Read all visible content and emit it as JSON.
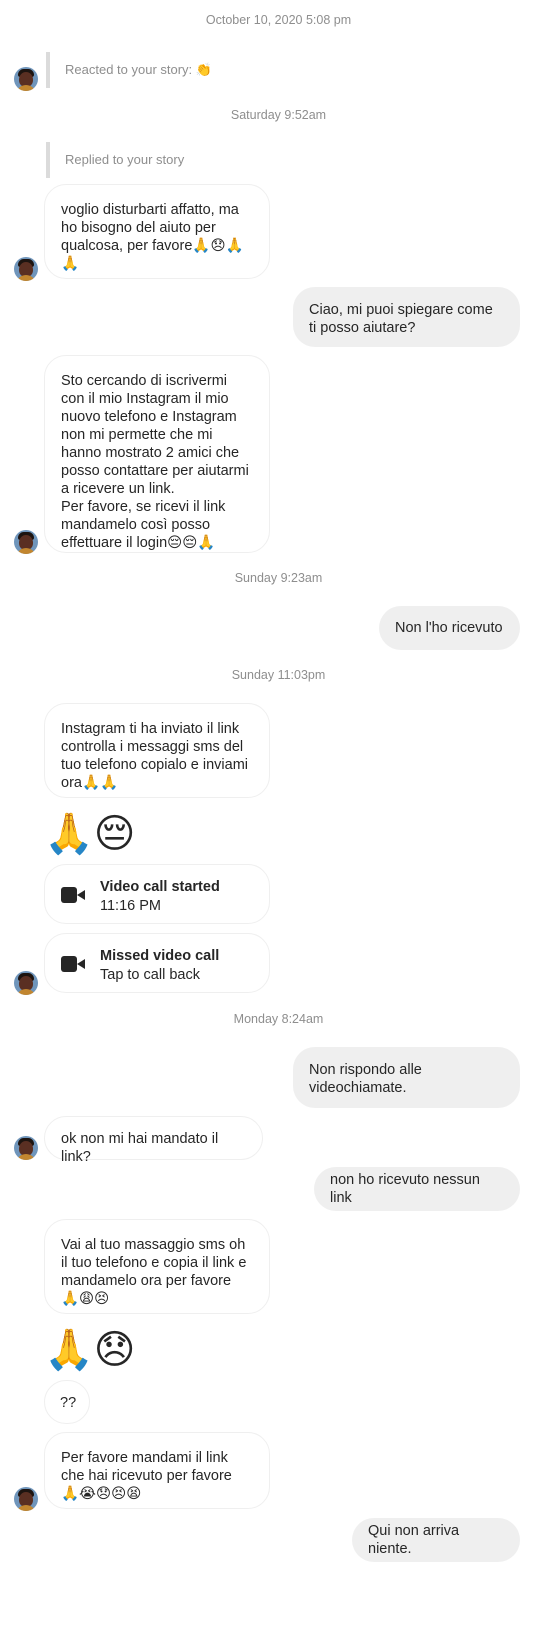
{
  "timestamps": {
    "t1": "October 10, 2020 5:08 pm",
    "t2": "Saturday 9:52am",
    "t3": "Sunday 9:23am",
    "t4": "Sunday 11:03pm",
    "t5": "Monday 8:24am"
  },
  "story_notes": {
    "reacted": "Reacted to your story: 👏",
    "replied": "Replied to your story"
  },
  "messages": {
    "m1": "voglio disturbarti affatto, ma ho bisogno del aiuto per qualcosa, per favore🙏😞🙏🙏",
    "m2": "Ciao, mi puoi spiegare come ti posso aiutare?",
    "m3": "Sto cercando di iscrivermi con il mio Instagram il mio nuovo telefono e Instagram non mi permette che mi hanno mostrato 2 amici che posso contattare per aiutarmi a ricevere un link.\nPer favore, se ricevi il link mandamelo così posso effettuare il login😔😔🙏",
    "m4": "Non l'ho ricevuto",
    "m5": "Instagram ti ha inviato il link controlla i messaggi sms del tuo telefono copialo e inviami ora🙏🙏",
    "m6": "🙏😔",
    "m7": "Non rispondo alle videochiamate.",
    "m8": "ok non mi hai mandato il link?",
    "m9": "non ho ricevuto nessun link",
    "m10": "Vai al tuo massaggio sms oh il tuo telefono e copia il link e mandamelo ora per favore 🙏😩😣",
    "m11": "🙏😞",
    "m12": "??",
    "m13": "Per favore mandami il link che hai ricevuto per favore 🙏😭😞😣😫",
    "m14": "Qui non arriva niente."
  },
  "calls": {
    "started_title": "Video call started",
    "started_time": "11:16 PM",
    "missed_title": "Missed video call",
    "missed_sub": "Tap to call back"
  },
  "icons": [
    "video-camera-icon",
    "avatar"
  ]
}
